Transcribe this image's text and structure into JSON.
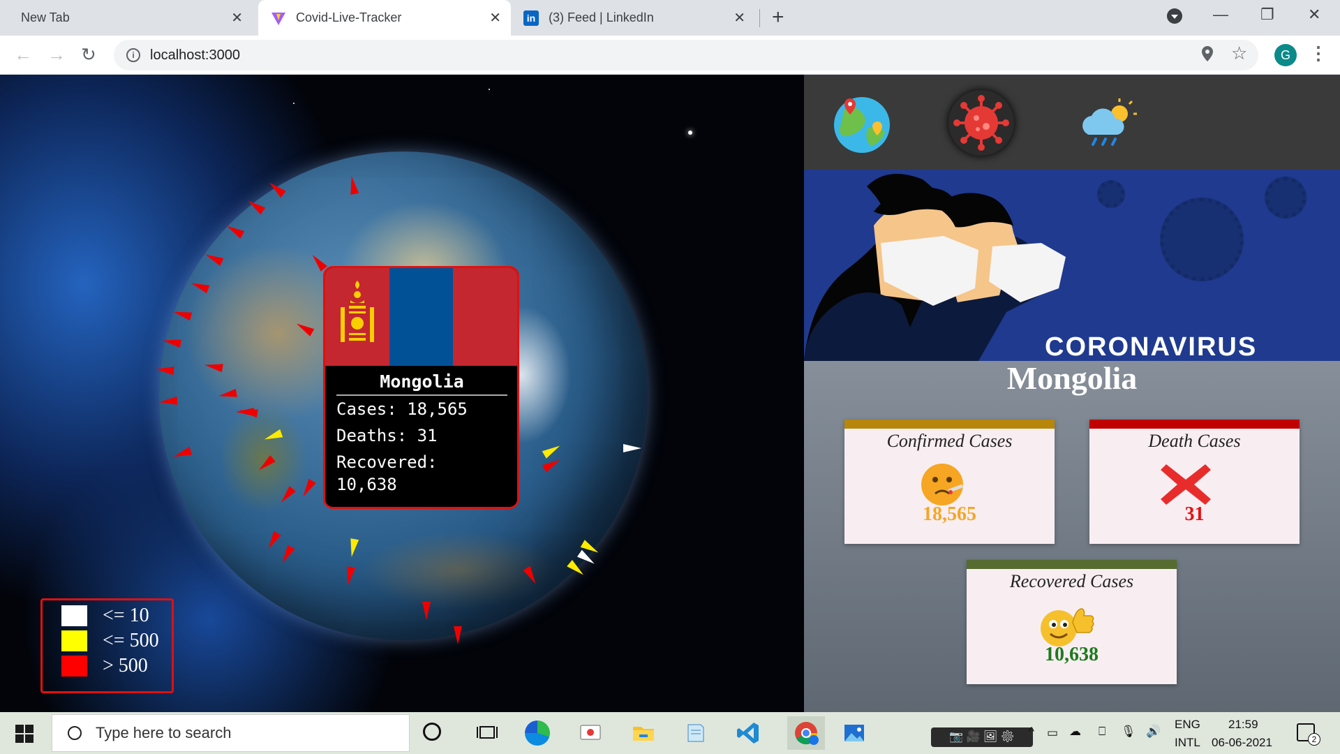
{
  "browser": {
    "tabs": [
      {
        "title": "New Tab"
      },
      {
        "title": "Covid-Live-Tracker"
      },
      {
        "title": "(3) Feed | LinkedIn"
      }
    ],
    "url": "localhost:3000",
    "profile_initial": "G"
  },
  "globe": {
    "popup": {
      "country": "Mongolia",
      "cases_line": "Cases: 18,565",
      "deaths_line": "Deaths: 31",
      "recovered_label": "Recovered:",
      "recovered_value": "10,638",
      "flag_colors": [
        "#c4272f",
        "#015197",
        "#c4272f"
      ],
      "soyombo_color": "#f9cf02"
    },
    "legend": [
      {
        "label": "<= 10",
        "color": "#ffffff"
      },
      {
        "label": "<= 500",
        "color": "#ffff00"
      },
      {
        "label": "> 500",
        "color": "#ff0000"
      }
    ]
  },
  "panel": {
    "nav_icons": [
      "globe-map-icon",
      "virus-icon",
      "weather-icon"
    ],
    "banner_title": "CORONAVIRUS",
    "country": "Mongolia",
    "cards": {
      "confirmed": {
        "title": "Confirmed Cases",
        "value": "18,565",
        "color": "#f5a623",
        "bar": "#b8860b"
      },
      "deaths": {
        "title": "Death Cases",
        "value": "31",
        "color": "#e81010",
        "bar": "#c00000"
      },
      "recovered": {
        "title": "Recovered Cases",
        "value": "10,638",
        "color": "#1e7a1e",
        "bar": "#556b2f"
      }
    }
  },
  "taskbar": {
    "search_placeholder": "Type here to search",
    "lang1": "ENG",
    "lang2": "INTL",
    "time": "21:59",
    "date": "06-06-2021",
    "notifications": "2"
  }
}
